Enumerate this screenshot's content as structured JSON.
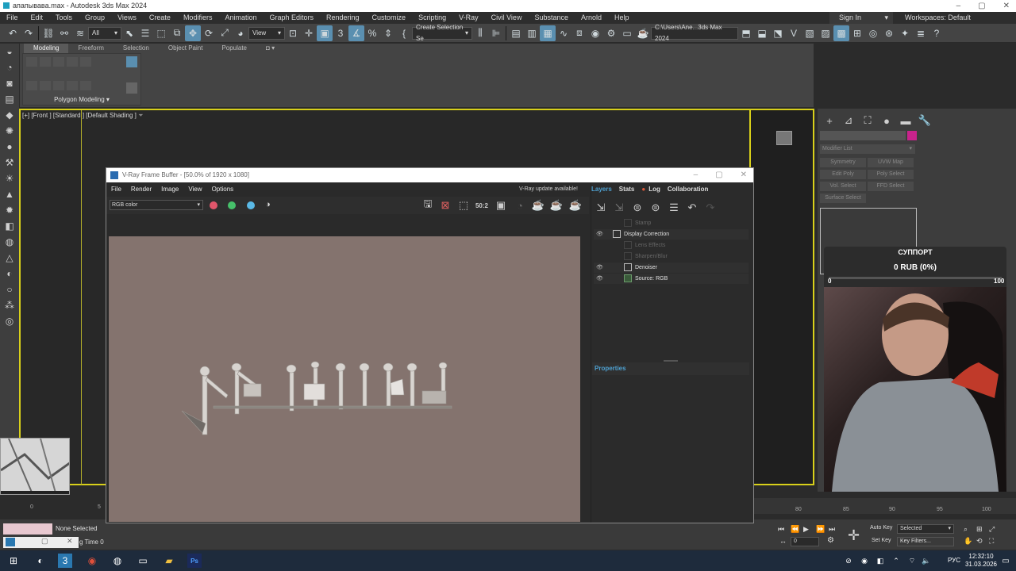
{
  "window": {
    "title": "апапывава.max - Autodesk 3ds Max 2024"
  },
  "menu": [
    "File",
    "Edit",
    "Tools",
    "Group",
    "Views",
    "Create",
    "Modifiers",
    "Animation",
    "Graph Editors",
    "Rendering",
    "Customize",
    "Scripting",
    "V-Ray",
    "Civil View",
    "Substance",
    "Arnold",
    "Help"
  ],
  "account": {
    "sign_in": "Sign In",
    "workspaces": "Workspaces: Default"
  },
  "toolbar": {
    "selection_filter": "All",
    "ref_coord": "View",
    "named_selection": "Create Selection Se",
    "path": "C:\\Users\\Ane...3ds Max 2024"
  },
  "ribbon": {
    "tabs": [
      "Modeling",
      "Freeform",
      "Selection",
      "Object Paint",
      "Populate"
    ],
    "active_tab": "Modeling",
    "panel_label": "Polygon Modeling"
  },
  "viewport": {
    "label": "[+] [Front ] [Standard ] [Default Shading ]"
  },
  "command_panel": {
    "modifier_list": "Modifier List",
    "buttons": [
      "Symmetry",
      "UVW Map",
      "Edit Poly",
      "Poly Select",
      "Vol. Select",
      "FFD Select",
      "Surface Select"
    ]
  },
  "support": {
    "title": "СУППОРТ",
    "amount": "0 RUB (0%)",
    "min": "0",
    "max": "100",
    "progress": 0
  },
  "timeline": {
    "ticks": [
      "80",
      "85",
      "90",
      "95",
      "100"
    ],
    "left_ticks": [
      "0",
      "5"
    ]
  },
  "status": {
    "selection": "None Selected",
    "add_time_tag": "g Time 0",
    "auto_key": "Auto Key",
    "selected": "Selected",
    "set_key": "Set Key",
    "key_filters": "Key Filters...",
    "frame": "0"
  },
  "vfb": {
    "title": "V-Ray Frame Buffer - [50.0% of 1920 x 1080]",
    "menu": [
      "File",
      "Render",
      "Image",
      "View",
      "Options"
    ],
    "update_notice": "V-Ray update available!",
    "channel": "RGB color",
    "channel_colors": [
      "#e0566b",
      "#46c06a",
      "#5ab9e6"
    ],
    "panel_tabs": [
      "Layers",
      "Stats",
      "Log",
      "Collaboration"
    ],
    "layers": [
      {
        "name": "Stamp",
        "visible": false,
        "indent": 1,
        "enabled": false
      },
      {
        "name": "Display Correction",
        "visible": true,
        "indent": 0,
        "enabled": true
      },
      {
        "name": "Lens Effects",
        "visible": false,
        "indent": 1,
        "enabled": false
      },
      {
        "name": "Sharpen/Blur",
        "visible": false,
        "indent": 1,
        "enabled": false
      },
      {
        "name": "Denoiser",
        "visible": true,
        "indent": 1,
        "enabled": true
      },
      {
        "name": "Source: RGB",
        "visible": true,
        "indent": 1,
        "enabled": true
      }
    ],
    "properties_label": "Properties",
    "render_bg": "#84736e"
  },
  "taskbar": {
    "lang": "РУС",
    "time": "12:32:10",
    "date": "31.03.2026"
  },
  "colors": {
    "viewport_border": "#d8d01a",
    "accent": "#4ea0d0",
    "object_color": "#c8238c"
  }
}
